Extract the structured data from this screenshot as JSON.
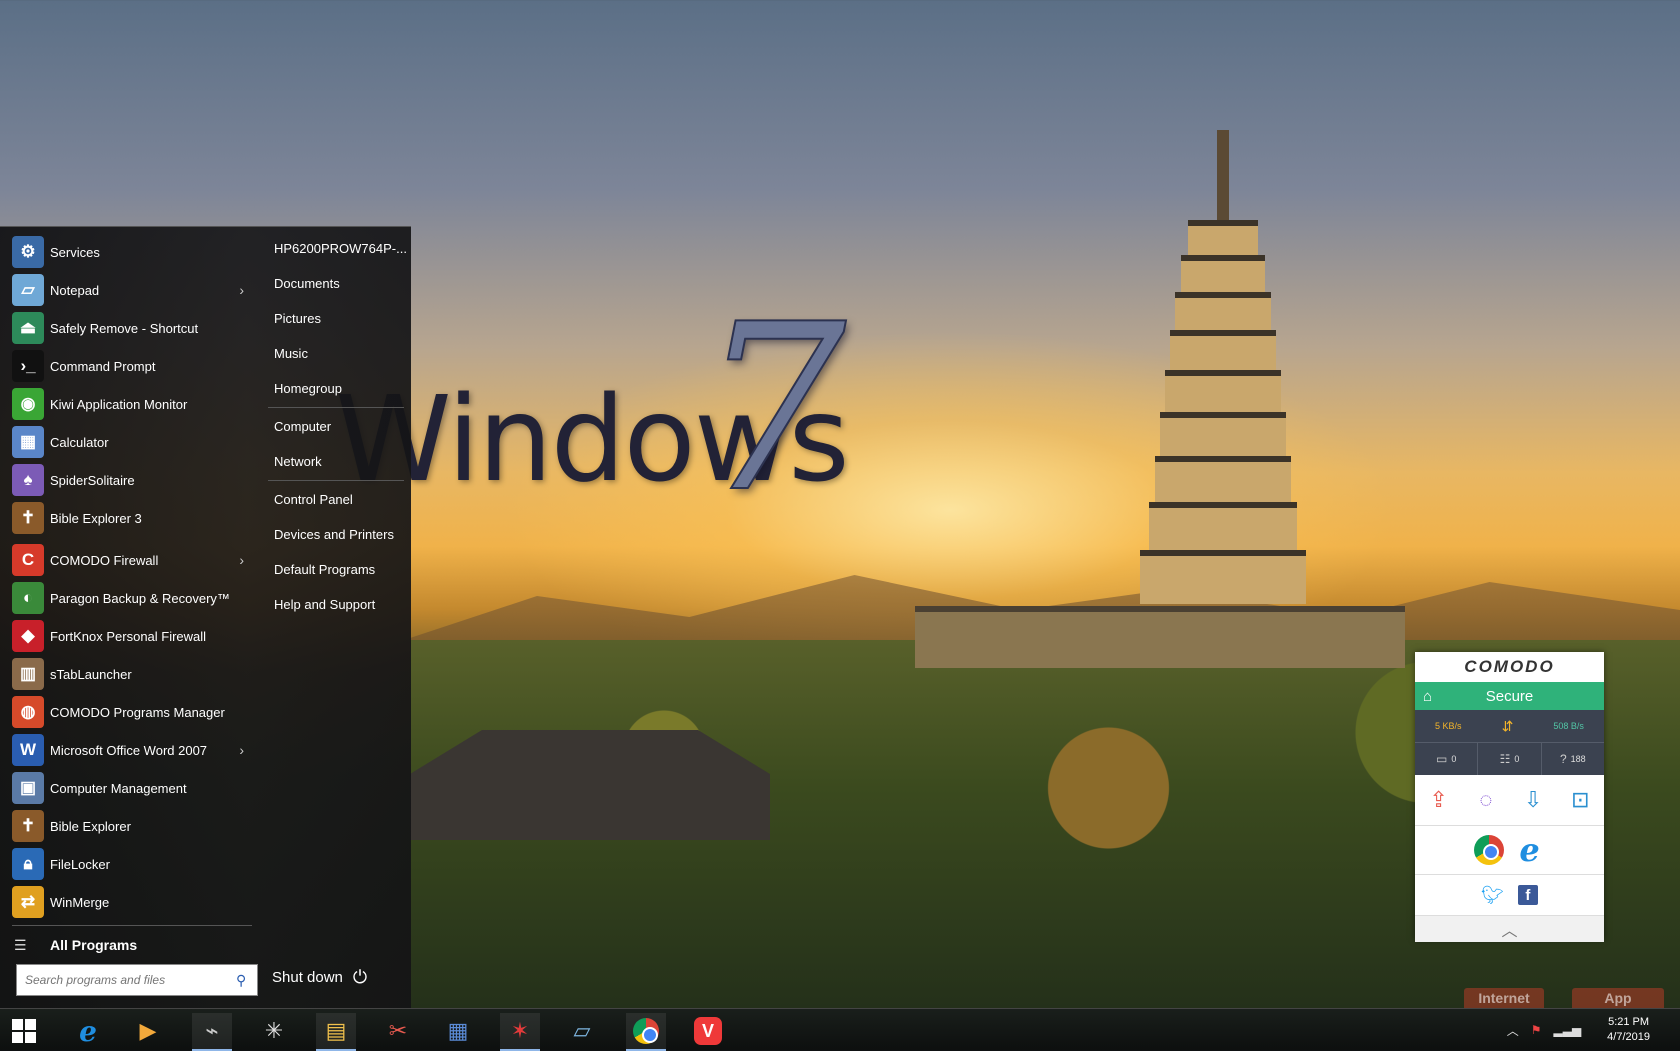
{
  "desktop": {
    "wallpaper_text": "Windows",
    "wallpaper_number": "7"
  },
  "start_menu": {
    "programs": [
      {
        "label": "Services",
        "icon": "gear-icon",
        "has_submenu": false
      },
      {
        "label": "Notepad",
        "icon": "notepad-icon",
        "has_submenu": true
      },
      {
        "label": "Safely Remove - Shortcut",
        "icon": "usb-remove-icon",
        "has_submenu": false
      },
      {
        "label": "Command Prompt",
        "icon": "terminal-icon",
        "has_submenu": false
      },
      {
        "label": "Kiwi Application Monitor",
        "icon": "kiwi-icon",
        "has_submenu": false
      },
      {
        "label": "Calculator",
        "icon": "calculator-icon",
        "has_submenu": false
      },
      {
        "label": "SpiderSolitaire",
        "icon": "cards-icon",
        "has_submenu": false
      },
      {
        "label": "Bible Explorer 3",
        "icon": "book-icon",
        "has_submenu": false
      }
    ],
    "programs_more": [
      {
        "label": "COMODO Firewall",
        "icon": "comodo-firewall-icon",
        "has_submenu": true
      },
      {
        "label": "Paragon Backup & Recovery™",
        "icon": "backup-icon",
        "has_submenu": false
      },
      {
        "label": "FortKnox Personal Firewall",
        "icon": "shield-icon",
        "has_submenu": false
      },
      {
        "label": "sTabLauncher",
        "icon": "launcher-icon",
        "has_submenu": false
      },
      {
        "label": "COMODO Programs Manager",
        "icon": "programs-manager-icon",
        "has_submenu": false
      },
      {
        "label": "Microsoft Office Word 2007",
        "icon": "word-icon",
        "has_submenu": true
      },
      {
        "label": "Computer Management",
        "icon": "computer-management-icon",
        "has_submenu": false
      },
      {
        "label": "Bible Explorer",
        "icon": "book-icon",
        "has_submenu": false
      },
      {
        "label": "FileLocker",
        "icon": "lock-icon",
        "has_submenu": false
      },
      {
        "label": "WinMerge",
        "icon": "merge-icon",
        "has_submenu": false
      }
    ],
    "all_programs_label": "All Programs",
    "search_placeholder": "Search programs and files",
    "right_items_a": [
      "HP6200PROW764P-...",
      "Documents",
      "Pictures",
      "Music",
      "Homegroup"
    ],
    "right_items_b": [
      "Computer",
      "Network"
    ],
    "right_items_c": [
      "Control Panel",
      "Devices and Printers",
      "Default Programs",
      "Help and Support"
    ],
    "shutdown_label": "Shut down"
  },
  "comodo_widget": {
    "brand": "COMODO",
    "status": "Secure",
    "download_speed": "5 KB/s",
    "upload_speed": "508 B/s",
    "count_sandboxed": "0",
    "count_processes": "0",
    "count_unknown": "188",
    "colors": {
      "secure": "#2fb27a",
      "panel": "#3b4250",
      "download": "#f4b52a",
      "upload": "#52c6a6"
    }
  },
  "background_tabs": [
    "Internet",
    "App"
  ],
  "taskbar": {
    "pinned": [
      "internet-explorer-icon",
      "media-player-icon",
      "usb-drive-icon",
      "network-app-icon",
      "file-explorer-icon",
      "snipping-tool-icon",
      "word-document-icon",
      "splat-app-icon",
      "notepad-icon",
      "chrome-icon",
      "vivaldi-icon"
    ],
    "clock_time": "5:21 PM",
    "clock_date": "4/7/2019"
  }
}
